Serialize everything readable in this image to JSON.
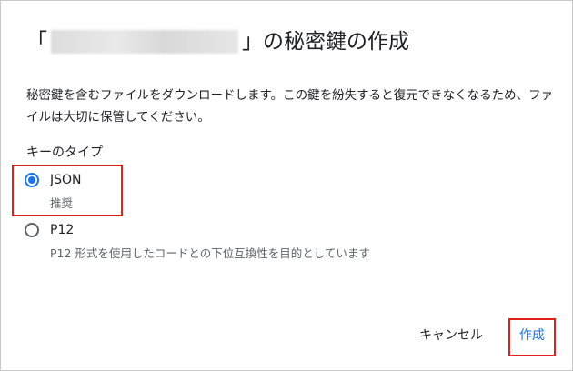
{
  "dialog": {
    "title_prefix": "「",
    "title_suffix": "」の秘密鍵の作成",
    "description": "秘密鍵を含むファイルをダウンロードします。この鍵を紛失すると復元できなくなるため、ファイルは大切に保管してください。",
    "key_type_label": "キーのタイプ",
    "options": [
      {
        "label": "JSON",
        "sublabel": "推奨",
        "selected": true
      },
      {
        "label": "P12",
        "sublabel": "P12 形式を使用したコードとの下位互換性を目的としています",
        "selected": false
      }
    ],
    "buttons": {
      "cancel": "キャンセル",
      "create": "作成"
    }
  },
  "colors": {
    "accent": "#1a73e8",
    "highlight": "#e0201b"
  }
}
